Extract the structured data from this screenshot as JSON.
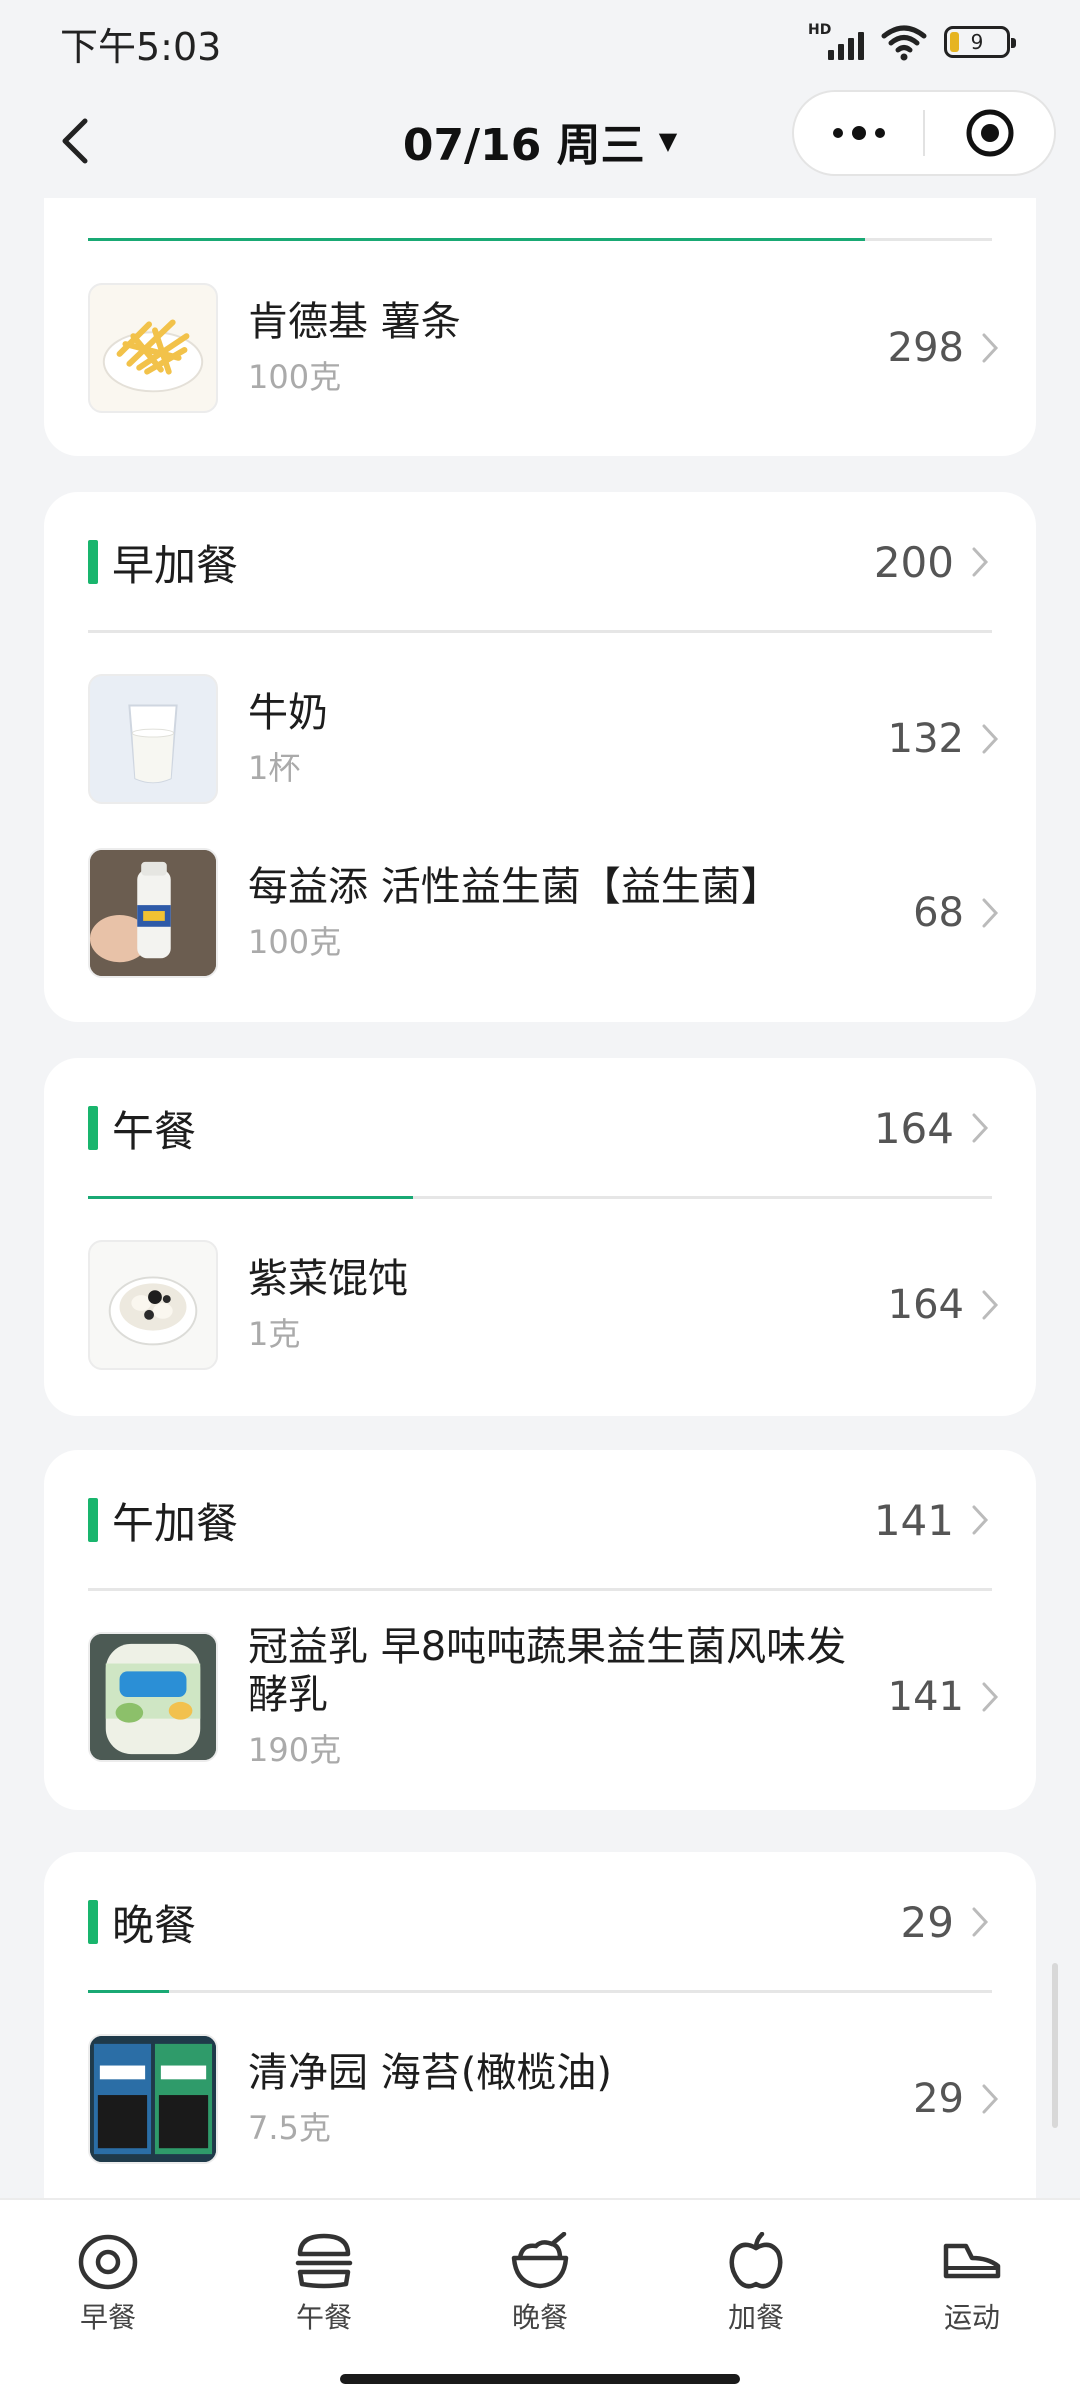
{
  "status_bar": {
    "time": "下午5:03",
    "signal_label": "HD",
    "battery": "9"
  },
  "nav": {
    "title": "07/16 周三",
    "caret": "▼"
  },
  "meals": [
    {
      "title": "",
      "progress": 0.86,
      "foods": [
        {
          "name": "肯德基 薯条",
          "amount": "100克",
          "kcal": "298",
          "thumb": "fries-thumb"
        }
      ]
    },
    {
      "title": "早加餐",
      "kcal": "200",
      "progress": 0,
      "foods": [
        {
          "name": "牛奶",
          "amount": "1杯",
          "kcal": "132",
          "thumb": "milk-thumb"
        },
        {
          "name": "每益添 活性益生菌【益生菌】",
          "amount": "100克",
          "kcal": "68",
          "thumb": "probiotic-bottle-thumb"
        }
      ]
    },
    {
      "title": "午餐",
      "kcal": "164",
      "progress": 0.36,
      "foods": [
        {
          "name": "紫菜馄饨",
          "amount": "1克",
          "kcal": "164",
          "thumb": "wonton-thumb"
        }
      ]
    },
    {
      "title": "午加餐",
      "kcal": "141",
      "progress": 0,
      "foods": [
        {
          "name": "冠益乳 早8吨吨蔬果益生菌风味发酵乳",
          "amount": "190克",
          "kcal": "141",
          "thumb": "yogurt-bottle-thumb"
        }
      ]
    },
    {
      "title": "晚餐",
      "kcal": "29",
      "progress": 0.09,
      "foods": [
        {
          "name": "清净园 海苔(橄榄油)",
          "amount": "7.5克",
          "kcal": "29",
          "thumb": "seaweed-thumb"
        }
      ]
    }
  ],
  "tabs": [
    {
      "label": "早餐",
      "icon": "egg-icon"
    },
    {
      "label": "午餐",
      "icon": "burger-icon"
    },
    {
      "label": "晚餐",
      "icon": "rice-bowl-icon"
    },
    {
      "label": "加餐",
      "icon": "apple-icon"
    },
    {
      "label": "运动",
      "icon": "sneaker-icon"
    }
  ],
  "colors": {
    "accent": "#19b56d",
    "progress": "#19a974",
    "background": "#f3f4f6"
  }
}
